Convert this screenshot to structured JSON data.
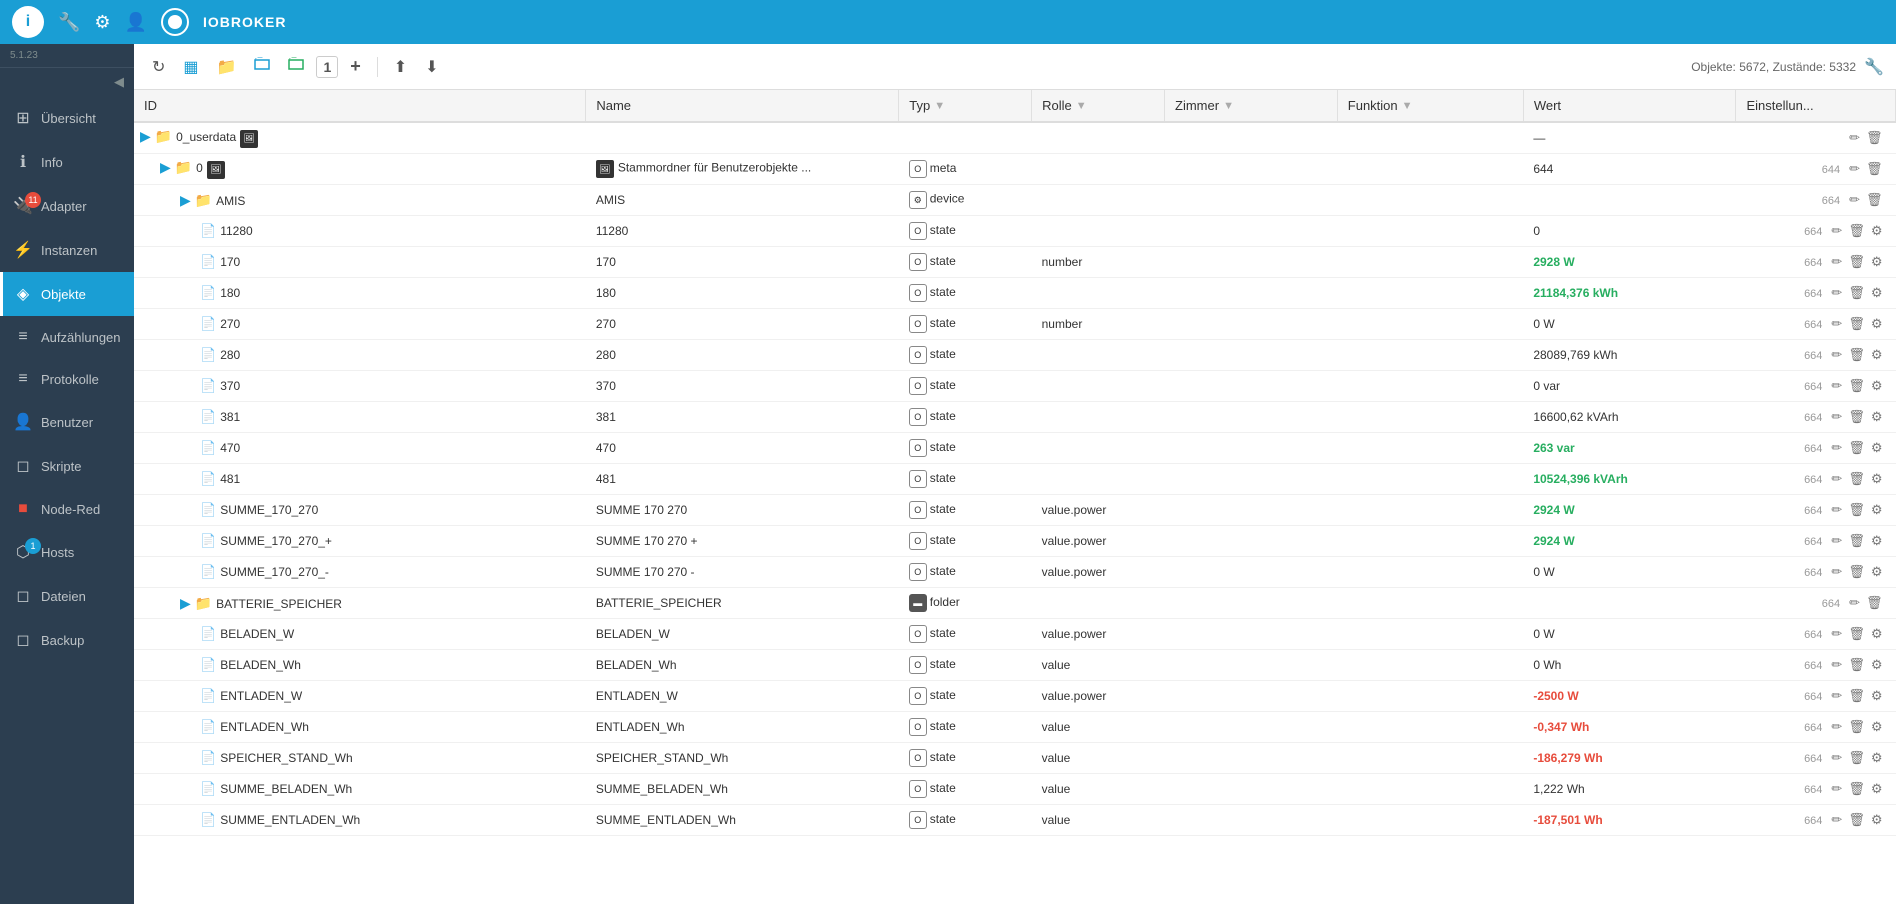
{
  "app": {
    "version": "5.1.23",
    "brand": "IOBROKER",
    "logo": "i"
  },
  "topbar": {
    "icons": [
      "wrench",
      "gear",
      "person",
      "circle"
    ]
  },
  "sidebar": {
    "items": [
      {
        "id": "uebersicht",
        "label": "Übersicht",
        "icon": "⊞",
        "badge": null,
        "active": false
      },
      {
        "id": "info",
        "label": "Info",
        "icon": "ℹ",
        "badge": null,
        "active": false
      },
      {
        "id": "adapter",
        "label": "Adapter",
        "icon": "🔌",
        "badge": "11",
        "badgeColor": "red",
        "active": false
      },
      {
        "id": "instanzen",
        "label": "Instanzen",
        "icon": "⚡",
        "badge": null,
        "active": false
      },
      {
        "id": "objekte",
        "label": "Objekte",
        "icon": "◈",
        "badge": null,
        "active": true
      },
      {
        "id": "aufzaehlungen",
        "label": "Aufzählungen",
        "icon": "≡",
        "badge": null,
        "active": false
      },
      {
        "id": "protokolle",
        "label": "Protokolle",
        "icon": "≡",
        "badge": null,
        "active": false
      },
      {
        "id": "benutzer",
        "label": "Benutzer",
        "icon": "👤",
        "badge": null,
        "active": false
      },
      {
        "id": "skripte",
        "label": "Skripte",
        "icon": "◻",
        "badge": null,
        "active": false
      },
      {
        "id": "node-red",
        "label": "Node-Red",
        "icon": "■",
        "badge": null,
        "active": false,
        "redIcon": true
      },
      {
        "id": "hosts",
        "label": "Hosts",
        "icon": "⬡",
        "badge": "1",
        "badgeColor": "blue",
        "active": false
      },
      {
        "id": "dateien",
        "label": "Dateien",
        "icon": "◻",
        "badge": null,
        "active": false
      },
      {
        "id": "backup",
        "label": "Backup",
        "icon": "◻",
        "badge": null,
        "active": false
      }
    ]
  },
  "toolbar": {
    "info": "Objekte: 5672, Zustände: 5332",
    "buttons": [
      {
        "id": "refresh",
        "icon": "↻",
        "tooltip": "Refresh"
      },
      {
        "id": "view-list",
        "icon": "▦",
        "tooltip": "List view",
        "active": true
      },
      {
        "id": "add-folder",
        "icon": "📁+",
        "tooltip": "Add folder"
      },
      {
        "id": "open-folder",
        "icon": "📂",
        "tooltip": "Open"
      },
      {
        "id": "folder-color",
        "icon": "📁",
        "tooltip": "Folder"
      },
      {
        "id": "number",
        "icon": "1",
        "tooltip": "Number"
      },
      {
        "id": "plus",
        "icon": "+",
        "tooltip": "Add"
      },
      {
        "id": "upload",
        "icon": "⬆",
        "tooltip": "Upload"
      },
      {
        "id": "download",
        "icon": "⬇",
        "tooltip": "Download"
      }
    ]
  },
  "table": {
    "columns": [
      {
        "id": "id",
        "label": "ID"
      },
      {
        "id": "name",
        "label": "Name"
      },
      {
        "id": "typ",
        "label": "Typ",
        "filterable": true
      },
      {
        "id": "rolle",
        "label": "Rolle",
        "filterable": true
      },
      {
        "id": "zimmer",
        "label": "Zimmer",
        "filterable": true
      },
      {
        "id": "funktion",
        "label": "Funktion",
        "filterable": true
      },
      {
        "id": "wert",
        "label": "Wert"
      },
      {
        "id": "einstellung",
        "label": "Einstellun..."
      }
    ],
    "rows": [
      {
        "id": "0_userdata",
        "indent": 0,
        "type": "folder",
        "icon": "folder",
        "imgIcon": true,
        "name": "",
        "typ": "",
        "rolle": "",
        "zimmer": "",
        "funktion": "",
        "wert": "—",
        "num": "",
        "valueClass": "value-normal"
      },
      {
        "id": "0",
        "indent": 1,
        "type": "folder",
        "icon": "folder",
        "imgIcon": true,
        "name": "Stammordner für Benutzerobjekte ...",
        "typ": "meta",
        "rolle": "",
        "zimmer": "",
        "funktion": "",
        "wert": "644",
        "num": "644",
        "valueClass": "value-normal"
      },
      {
        "id": "AMIS",
        "indent": 2,
        "type": "folder",
        "icon": "folder",
        "name": "AMIS",
        "typ": "device",
        "typIcon": "device",
        "rolle": "",
        "zimmer": "",
        "funktion": "",
        "wert": "",
        "num": "664",
        "valueClass": "value-normal"
      },
      {
        "id": "11280",
        "indent": 3,
        "type": "file",
        "icon": "file",
        "name": "11280",
        "typ": "state",
        "typIcon": "state",
        "rolle": "",
        "zimmer": "",
        "funktion": "",
        "wert": "0",
        "num": "664",
        "valueClass": "value-normal"
      },
      {
        "id": "170",
        "indent": 3,
        "type": "file",
        "icon": "file",
        "name": "170",
        "typ": "state",
        "typIcon": "state",
        "rolle": "number",
        "zimmer": "",
        "funktion": "",
        "wert": "2928 W",
        "num": "664",
        "valueClass": "value-green"
      },
      {
        "id": "180",
        "indent": 3,
        "type": "file",
        "icon": "file",
        "name": "180",
        "typ": "state",
        "typIcon": "state",
        "rolle": "",
        "zimmer": "",
        "funktion": "",
        "wert": "21184,376 kWh",
        "num": "664",
        "valueClass": "value-green"
      },
      {
        "id": "270",
        "indent": 3,
        "type": "file",
        "icon": "file",
        "name": "270",
        "typ": "state",
        "typIcon": "state",
        "rolle": "number",
        "zimmer": "",
        "funktion": "",
        "wert": "0 W",
        "num": "664",
        "valueClass": "value-normal"
      },
      {
        "id": "280",
        "indent": 3,
        "type": "file",
        "icon": "file",
        "name": "280",
        "typ": "state",
        "typIcon": "state",
        "rolle": "",
        "zimmer": "",
        "funktion": "",
        "wert": "28089,769 kWh",
        "num": "664",
        "valueClass": "value-normal"
      },
      {
        "id": "370",
        "indent": 3,
        "type": "file",
        "icon": "file",
        "name": "370",
        "typ": "state",
        "typIcon": "state",
        "rolle": "",
        "zimmer": "",
        "funktion": "",
        "wert": "0 var",
        "num": "664",
        "valueClass": "value-normal"
      },
      {
        "id": "381",
        "indent": 3,
        "type": "file",
        "icon": "file",
        "name": "381",
        "typ": "state",
        "typIcon": "state",
        "rolle": "",
        "zimmer": "",
        "funktion": "",
        "wert": "16600,62 kVArh",
        "num": "664",
        "valueClass": "value-normal"
      },
      {
        "id": "470",
        "indent": 3,
        "type": "file",
        "icon": "file",
        "name": "470",
        "typ": "state",
        "typIcon": "state",
        "rolle": "",
        "zimmer": "",
        "funktion": "",
        "wert": "263 var",
        "num": "664",
        "valueClass": "value-green"
      },
      {
        "id": "481",
        "indent": 3,
        "type": "file",
        "icon": "file",
        "name": "481",
        "typ": "state",
        "typIcon": "state",
        "rolle": "",
        "zimmer": "",
        "funktion": "",
        "wert": "10524,396 kVArh",
        "num": "664",
        "valueClass": "value-green"
      },
      {
        "id": "SUMME_170_270",
        "indent": 3,
        "type": "file",
        "icon": "file",
        "name": "SUMME 170 270",
        "typ": "state",
        "typIcon": "state",
        "rolle": "value.power",
        "zimmer": "",
        "funktion": "",
        "wert": "2924 W",
        "num": "664",
        "valueClass": "value-green"
      },
      {
        "id": "SUMME_170_270_+",
        "indent": 3,
        "type": "file",
        "icon": "file",
        "name": "SUMME 170 270 +",
        "typ": "state",
        "typIcon": "state",
        "rolle": "value.power",
        "zimmer": "",
        "funktion": "",
        "wert": "2924 W",
        "num": "664",
        "valueClass": "value-green"
      },
      {
        "id": "SUMME_170_270_-",
        "indent": 3,
        "type": "file",
        "icon": "file",
        "name": "SUMME 170 270 -",
        "typ": "state",
        "typIcon": "state",
        "rolle": "value.power",
        "zimmer": "",
        "funktion": "",
        "wert": "0 W",
        "num": "664",
        "valueClass": "value-normal"
      },
      {
        "id": "BATTERIE_SPEICHER",
        "indent": 2,
        "type": "folder",
        "icon": "folder",
        "name": "BATTERIE_SPEICHER",
        "typ": "folder",
        "typIcon": "folder",
        "rolle": "",
        "zimmer": "",
        "funktion": "",
        "wert": "",
        "num": "664",
        "valueClass": "value-normal"
      },
      {
        "id": "BELADEN_W",
        "indent": 3,
        "type": "file",
        "icon": "file",
        "name": "BELADEN_W",
        "typ": "state",
        "typIcon": "state",
        "rolle": "value.power",
        "zimmer": "",
        "funktion": "",
        "wert": "0 W",
        "num": "664",
        "valueClass": "value-normal"
      },
      {
        "id": "BELADEN_Wh",
        "indent": 3,
        "type": "file",
        "icon": "file",
        "name": "BELADEN_Wh",
        "typ": "state",
        "typIcon": "state",
        "rolle": "value",
        "zimmer": "",
        "funktion": "",
        "wert": "0 Wh",
        "num": "664",
        "valueClass": "value-normal"
      },
      {
        "id": "ENTLADEN_W",
        "indent": 3,
        "type": "file",
        "icon": "file",
        "name": "ENTLADEN_W",
        "typ": "state",
        "typIcon": "state",
        "rolle": "value.power",
        "zimmer": "",
        "funktion": "",
        "wert": "-2500 W",
        "num": "664",
        "valueClass": "value-negative"
      },
      {
        "id": "ENTLADEN_Wh",
        "indent": 3,
        "type": "file",
        "icon": "file",
        "name": "ENTLADEN_Wh",
        "typ": "state",
        "typIcon": "state",
        "rolle": "value",
        "zimmer": "",
        "funktion": "",
        "wert": "-0,347 Wh",
        "num": "664",
        "valueClass": "value-negative"
      },
      {
        "id": "SPEICHER_STAND_Wh",
        "indent": 3,
        "type": "file",
        "icon": "file",
        "name": "SPEICHER_STAND_Wh",
        "typ": "state",
        "typIcon": "state",
        "rolle": "value",
        "zimmer": "",
        "funktion": "",
        "wert": "-186,279 Wh",
        "num": "664",
        "valueClass": "value-negative"
      },
      {
        "id": "SUMME_BELADEN_Wh",
        "indent": 3,
        "type": "file",
        "icon": "file",
        "name": "SUMME_BELADEN_Wh",
        "typ": "state",
        "typIcon": "state",
        "rolle": "value",
        "zimmer": "",
        "funktion": "",
        "wert": "1,222 Wh",
        "num": "664",
        "valueClass": "value-normal"
      },
      {
        "id": "SUMME_ENTLADEN_Wh",
        "indent": 3,
        "type": "file",
        "icon": "file",
        "name": "SUMME_ENTLADEN_Wh",
        "typ": "state",
        "typIcon": "state",
        "rolle": "value",
        "zimmer": "",
        "funktion": "",
        "wert": "-187,501 Wh",
        "num": "664",
        "valueClass": "value-negative"
      }
    ]
  }
}
